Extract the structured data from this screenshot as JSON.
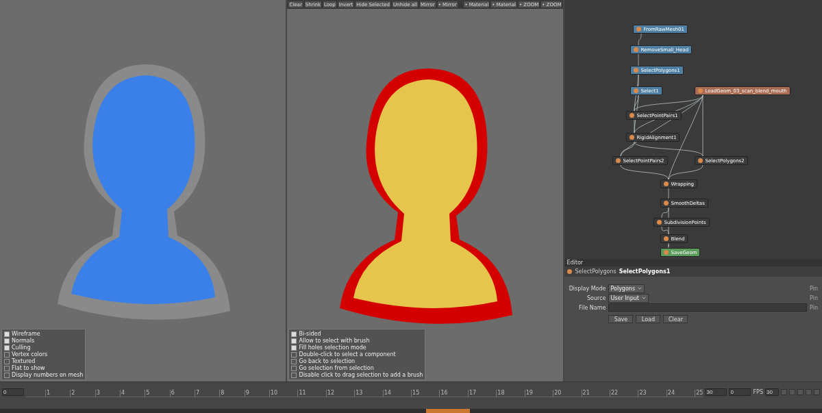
{
  "toolbar": {
    "items": [
      {
        "kind": "button",
        "label": "Clear"
      },
      {
        "kind": "button",
        "label": "Shrink"
      },
      {
        "kind": "button",
        "label": "Loop"
      },
      {
        "kind": "button",
        "label": "Invert"
      },
      {
        "kind": "button",
        "label": "Hide Selected"
      },
      {
        "kind": "button",
        "label": "Unhide all"
      },
      {
        "kind": "button",
        "label": "Mirror"
      },
      {
        "kind": "button",
        "label": "• Mirror"
      },
      {
        "kind": "field"
      },
      {
        "kind": "field"
      },
      {
        "kind": "button",
        "label": "• Material"
      },
      {
        "kind": "button",
        "label": "• Material"
      },
      {
        "kind": "button",
        "label": "• ZOOM"
      },
      {
        "kind": "button",
        "label": "• ZOOM"
      }
    ]
  },
  "viewports": [
    {
      "kind": "scan",
      "options": [
        {
          "label": "Wireframe",
          "checked": true
        },
        {
          "label": "Normals",
          "checked": true
        },
        {
          "label": "Culling",
          "checked": true
        },
        {
          "label": "Vertex colors",
          "checked": false
        },
        {
          "label": "Textured",
          "checked": false
        },
        {
          "label": "Flat to show",
          "checked": false
        },
        {
          "label": "Display numbers on mesh",
          "checked": false
        }
      ]
    },
    {
      "kind": "retopology",
      "options": [
        {
          "label": "Bi-sided",
          "checked": true
        },
        {
          "label": "Allow to select with brush",
          "checked": true
        },
        {
          "label": "Fill holes selection mode",
          "checked": true
        },
        {
          "label": "Double-click to select a component",
          "checked": false
        },
        {
          "label": "Go back to selection",
          "checked": false
        },
        {
          "label": "Go selection from selection",
          "checked": false
        },
        {
          "label": "Disable click to drag selection to add a brush",
          "checked": false
        }
      ]
    }
  ],
  "node_graph": {
    "nodes": [
      {
        "name": "FromRawMesh01",
        "color": "#4f7fa3"
      },
      {
        "name": "RemoveSmall_Head",
        "color": "#4f7fa3"
      },
      {
        "name": "SelectPolygons1",
        "color": "#4f7fa3"
      },
      {
        "name": "Select1",
        "color": "#4f7fa3"
      },
      {
        "name": "LoadGeom_03_scan_blend_mouth",
        "color": "#a86e55"
      },
      {
        "name": "SelectPointPairs1",
        "color": "#3b3b3b"
      },
      {
        "name": "RigidAlignment1",
        "color": "#3b3b3b"
      },
      {
        "name": "SelectPointPairs2",
        "color": "#3b3b3b"
      },
      {
        "name": "SelectPolygons2",
        "color": "#3b3b3b"
      },
      {
        "name": "Wrapping",
        "color": "#3b3b3b"
      },
      {
        "name": "SmoothDeltas",
        "color": "#3b3b3b"
      },
      {
        "name": "SubdivisionPoints",
        "color": "#3b3b3b"
      },
      {
        "name": "Blend",
        "color": "#3b3b3b"
      },
      {
        "name": "SaveGeom",
        "color": "#5a9a5a"
      }
    ]
  },
  "editor": {
    "title": "Editor",
    "node_type": "SelectPolygons",
    "node_name": "SelectPolygons1",
    "fields": [
      {
        "kind": "select",
        "label": "Display Mode",
        "value": "Polygons",
        "pin": "Pin"
      },
      {
        "kind": "select",
        "label": "Source",
        "value": "User Input",
        "pin": "Pin"
      },
      {
        "kind": "file",
        "label": "File Name",
        "pin": "Pin"
      }
    ],
    "buttons": [
      "Save",
      "Load",
      "Clear"
    ]
  },
  "timeline": {
    "start": "0",
    "ticks": [
      "1",
      "2",
      "3",
      "4",
      "5",
      "6",
      "7",
      "8",
      "9",
      "10",
      "11",
      "12",
      "13",
      "14",
      "15",
      "16",
      "17",
      "18",
      "19",
      "20",
      "21",
      "22",
      "23",
      "24",
      "25"
    ],
    "end": "30",
    "current": "0",
    "fps": "FPS",
    "fps_value": "30"
  }
}
